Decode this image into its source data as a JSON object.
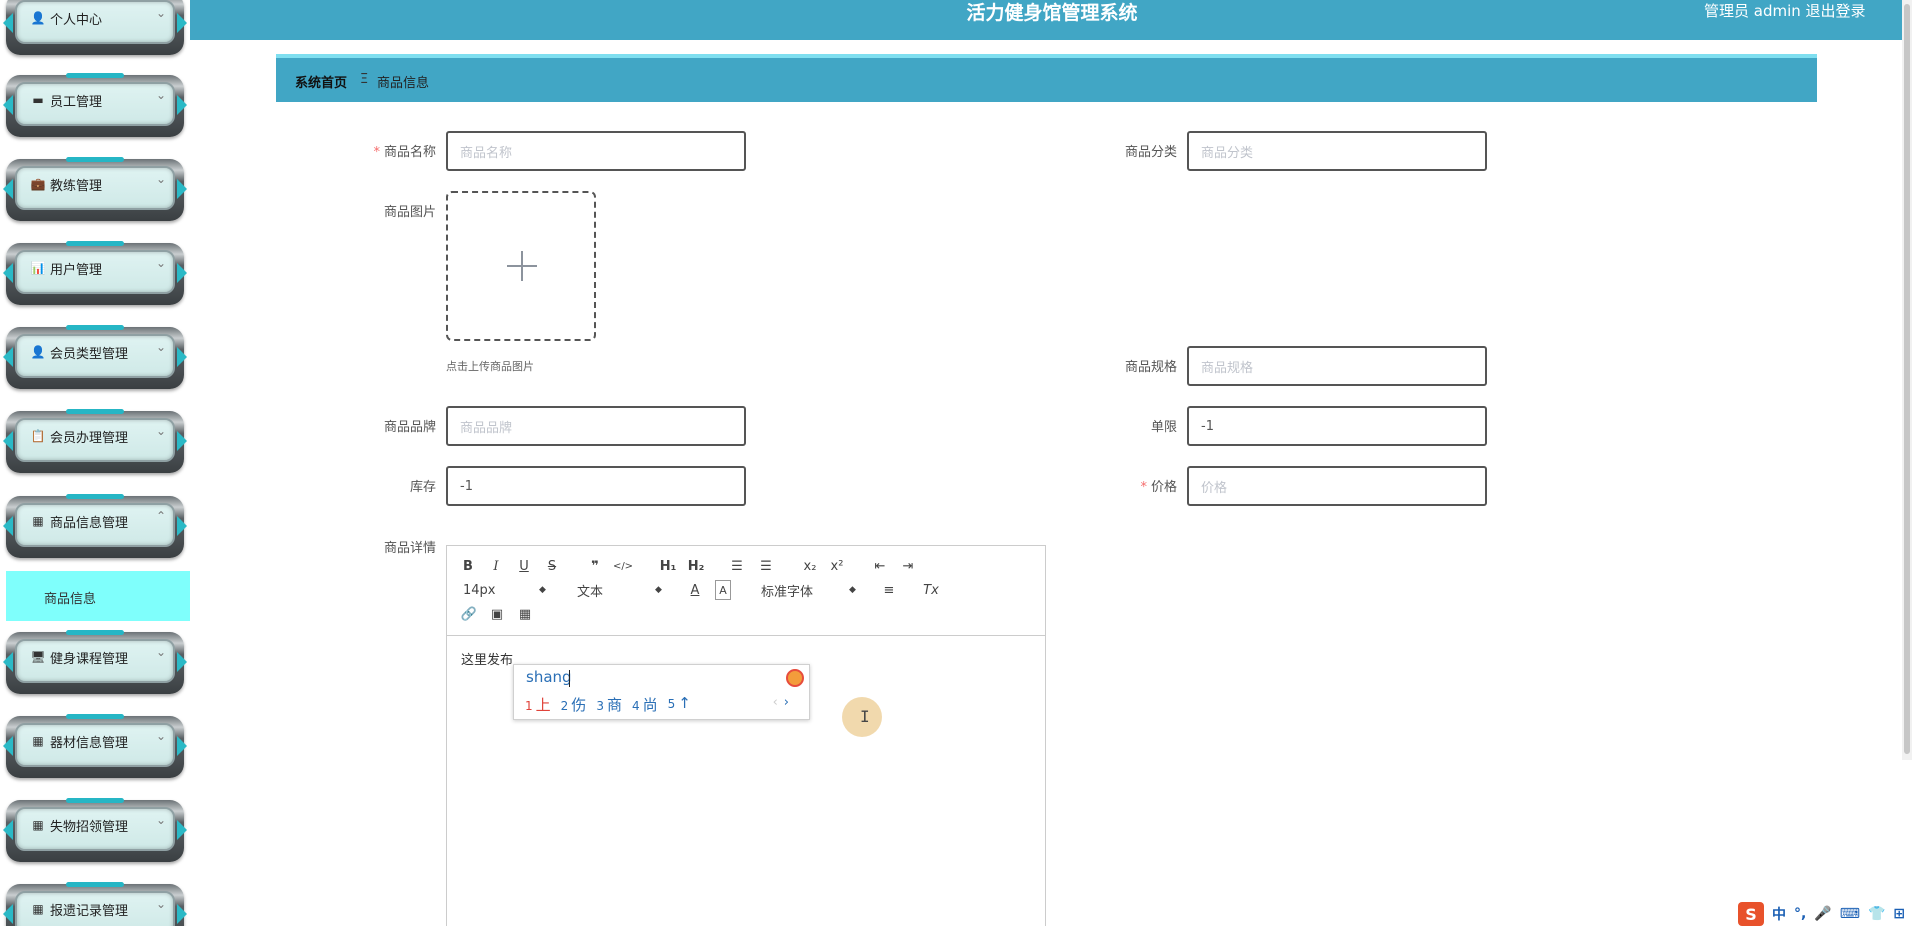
{
  "header": {
    "title": "活力健身馆管理系统",
    "user_text": "管理员 admin  退出登录"
  },
  "sidebar": {
    "items": [
      {
        "label": "个人中心",
        "icon": "user-icon",
        "chevron": "⌄"
      },
      {
        "label": "员工管理",
        "icon": "bookmark-icon",
        "chevron": "⌄"
      },
      {
        "label": "教练管理",
        "icon": "briefcase-icon",
        "chevron": "⌄"
      },
      {
        "label": "用户管理",
        "icon": "bar-chart-icon",
        "chevron": "⌄"
      },
      {
        "label": "会员类型管理",
        "icon": "user-icon",
        "chevron": "⌄"
      },
      {
        "label": "会员办理管理",
        "icon": "clipboard-icon",
        "chevron": "⌄"
      },
      {
        "label": "商品信息管理",
        "icon": "grid-icon",
        "chevron": "⌃"
      },
      {
        "label": "健身课程管理",
        "icon": "monitor-icon",
        "chevron": "⌄"
      },
      {
        "label": "器材信息管理",
        "icon": "grid-icon",
        "chevron": "⌄"
      },
      {
        "label": "失物招领管理",
        "icon": "grid-icon",
        "chevron": "⌄"
      },
      {
        "label": "报遗记录管理",
        "icon": "grid-icon",
        "chevron": "⌄"
      }
    ],
    "submenu": {
      "label": "商品信息"
    }
  },
  "breadcrumb": {
    "home": "系统首页",
    "separator": "Ξ",
    "current": "商品信息"
  },
  "form": {
    "name": {
      "label": "商品名称",
      "required": "*",
      "placeholder": "商品名称"
    },
    "category": {
      "label": "商品分类",
      "placeholder": "商品分类"
    },
    "image": {
      "label": "商品图片",
      "hint": "点击上传商品图片"
    },
    "spec": {
      "label": "商品规格",
      "placeholder": "商品规格"
    },
    "brand": {
      "label": "商品品牌",
      "placeholder": "商品品牌"
    },
    "limit": {
      "label": "单限",
      "value": "-1"
    },
    "stock": {
      "label": "库存",
      "value": "-1"
    },
    "price": {
      "label": "价格",
      "required": "*",
      "placeholder": "价格"
    },
    "detail": {
      "label": "商品详情",
      "content": "这里发布"
    }
  },
  "editor": {
    "font_size": "14px",
    "block_type": "文本",
    "font_family": "标准字体"
  },
  "ime": {
    "pinyin": "shang",
    "candidates": [
      {
        "n": "1",
        "text": "上"
      },
      {
        "n": "2",
        "text": "伤"
      },
      {
        "n": "3",
        "text": "商"
      },
      {
        "n": "4",
        "text": "尚"
      },
      {
        "n": "5",
        "text": "↑"
      }
    ]
  },
  "tray": {
    "items": [
      "中",
      "°,",
      "🎤",
      "⌨",
      "👕",
      "⊞"
    ]
  }
}
